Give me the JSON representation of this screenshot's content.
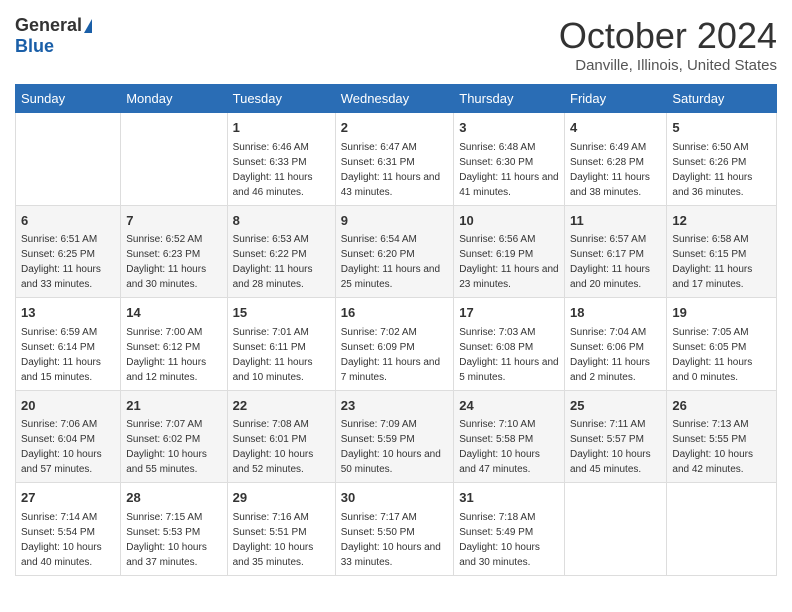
{
  "header": {
    "logo": {
      "general": "General",
      "blue": "Blue"
    },
    "title": "October 2024",
    "location": "Danville, Illinois, United States"
  },
  "weekdays": [
    "Sunday",
    "Monday",
    "Tuesday",
    "Wednesday",
    "Thursday",
    "Friday",
    "Saturday"
  ],
  "weeks": [
    [
      {
        "day": null
      },
      {
        "day": null
      },
      {
        "day": "1",
        "sunrise": "6:46 AM",
        "sunset": "6:33 PM",
        "daylight": "11 hours and 46 minutes."
      },
      {
        "day": "2",
        "sunrise": "6:47 AM",
        "sunset": "6:31 PM",
        "daylight": "11 hours and 43 minutes."
      },
      {
        "day": "3",
        "sunrise": "6:48 AM",
        "sunset": "6:30 PM",
        "daylight": "11 hours and 41 minutes."
      },
      {
        "day": "4",
        "sunrise": "6:49 AM",
        "sunset": "6:28 PM",
        "daylight": "11 hours and 38 minutes."
      },
      {
        "day": "5",
        "sunrise": "6:50 AM",
        "sunset": "6:26 PM",
        "daylight": "11 hours and 36 minutes."
      }
    ],
    [
      {
        "day": "6",
        "sunrise": "6:51 AM",
        "sunset": "6:25 PM",
        "daylight": "11 hours and 33 minutes."
      },
      {
        "day": "7",
        "sunrise": "6:52 AM",
        "sunset": "6:23 PM",
        "daylight": "11 hours and 30 minutes."
      },
      {
        "day": "8",
        "sunrise": "6:53 AM",
        "sunset": "6:22 PM",
        "daylight": "11 hours and 28 minutes."
      },
      {
        "day": "9",
        "sunrise": "6:54 AM",
        "sunset": "6:20 PM",
        "daylight": "11 hours and 25 minutes."
      },
      {
        "day": "10",
        "sunrise": "6:56 AM",
        "sunset": "6:19 PM",
        "daylight": "11 hours and 23 minutes."
      },
      {
        "day": "11",
        "sunrise": "6:57 AM",
        "sunset": "6:17 PM",
        "daylight": "11 hours and 20 minutes."
      },
      {
        "day": "12",
        "sunrise": "6:58 AM",
        "sunset": "6:15 PM",
        "daylight": "11 hours and 17 minutes."
      }
    ],
    [
      {
        "day": "13",
        "sunrise": "6:59 AM",
        "sunset": "6:14 PM",
        "daylight": "11 hours and 15 minutes."
      },
      {
        "day": "14",
        "sunrise": "7:00 AM",
        "sunset": "6:12 PM",
        "daylight": "11 hours and 12 minutes."
      },
      {
        "day": "15",
        "sunrise": "7:01 AM",
        "sunset": "6:11 PM",
        "daylight": "11 hours and 10 minutes."
      },
      {
        "day": "16",
        "sunrise": "7:02 AM",
        "sunset": "6:09 PM",
        "daylight": "11 hours and 7 minutes."
      },
      {
        "day": "17",
        "sunrise": "7:03 AM",
        "sunset": "6:08 PM",
        "daylight": "11 hours and 5 minutes."
      },
      {
        "day": "18",
        "sunrise": "7:04 AM",
        "sunset": "6:06 PM",
        "daylight": "11 hours and 2 minutes."
      },
      {
        "day": "19",
        "sunrise": "7:05 AM",
        "sunset": "6:05 PM",
        "daylight": "11 hours and 0 minutes."
      }
    ],
    [
      {
        "day": "20",
        "sunrise": "7:06 AM",
        "sunset": "6:04 PM",
        "daylight": "10 hours and 57 minutes."
      },
      {
        "day": "21",
        "sunrise": "7:07 AM",
        "sunset": "6:02 PM",
        "daylight": "10 hours and 55 minutes."
      },
      {
        "day": "22",
        "sunrise": "7:08 AM",
        "sunset": "6:01 PM",
        "daylight": "10 hours and 52 minutes."
      },
      {
        "day": "23",
        "sunrise": "7:09 AM",
        "sunset": "5:59 PM",
        "daylight": "10 hours and 50 minutes."
      },
      {
        "day": "24",
        "sunrise": "7:10 AM",
        "sunset": "5:58 PM",
        "daylight": "10 hours and 47 minutes."
      },
      {
        "day": "25",
        "sunrise": "7:11 AM",
        "sunset": "5:57 PM",
        "daylight": "10 hours and 45 minutes."
      },
      {
        "day": "26",
        "sunrise": "7:13 AM",
        "sunset": "5:55 PM",
        "daylight": "10 hours and 42 minutes."
      }
    ],
    [
      {
        "day": "27",
        "sunrise": "7:14 AM",
        "sunset": "5:54 PM",
        "daylight": "10 hours and 40 minutes."
      },
      {
        "day": "28",
        "sunrise": "7:15 AM",
        "sunset": "5:53 PM",
        "daylight": "10 hours and 37 minutes."
      },
      {
        "day": "29",
        "sunrise": "7:16 AM",
        "sunset": "5:51 PM",
        "daylight": "10 hours and 35 minutes."
      },
      {
        "day": "30",
        "sunrise": "7:17 AM",
        "sunset": "5:50 PM",
        "daylight": "10 hours and 33 minutes."
      },
      {
        "day": "31",
        "sunrise": "7:18 AM",
        "sunset": "5:49 PM",
        "daylight": "10 hours and 30 minutes."
      },
      {
        "day": null
      },
      {
        "day": null
      }
    ]
  ]
}
